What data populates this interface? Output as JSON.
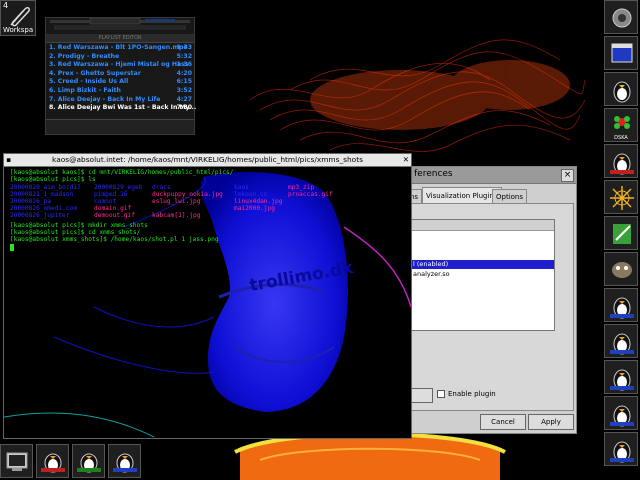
{
  "workspace": {
    "number": "4",
    "label": "Workspa"
  },
  "playlist": {
    "title": "PLAYLIST EDITOR",
    "items": [
      {
        "text": "1. Red Warszawa - Blt 1PO-Sangen.mp3",
        "time": "1:43"
      },
      {
        "text": "2. Prodigy - Breathe",
        "time": "5:32"
      },
      {
        "text": "3. Red Warszawa - Hjemi Mistal og Hass",
        "time": "1:36"
      },
      {
        "text": "4. Prex - Ghetto Superstar",
        "time": "4:20"
      },
      {
        "text": "5. Creed - Inside Us All",
        "time": "6:15"
      },
      {
        "text": "6. Limp Bizkit - Faith",
        "time": "3:52"
      },
      {
        "text": "7. Alice Deejay - Back In My Life",
        "time": "4:27"
      },
      {
        "text": "8. Alice Deejay Bwi Was 1st - Back In My...",
        "time": "7:30",
        "current": true
      }
    ]
  },
  "terminal": {
    "title": "kaos@absolut.intet: /home/kaos/mnt/VIRKELIG/homes/public_html/pics/xmms_shots",
    "lines": [
      {
        "text": "[kaos@absolut kaos]$ cd mnt/VIRKELIG/homes/public_html/pics/",
        "color": "#21e621"
      },
      {
        "text": "[kaos@absolut pics]$ ls",
        "color": "#21e621"
      },
      {
        "text": "[kaos@absolut pics]$ mkdir xmms_shots",
        "color": "#21e621"
      },
      {
        "text": "[kaos@absolut pics]$ cd xmms_shots/",
        "color": "#21e621"
      },
      {
        "text": "[kaos@absolut xmms_shots]$ /home/kaos/shot.pl 1 jass.png",
        "color": "#21e621"
      }
    ],
    "listing": [
      {
        "text": "20000820_aim_bord17",
        "color": "#2a2aff"
      },
      {
        "text": "20000829_egeb",
        "color": "#2a2aff"
      },
      {
        "text": "dracs",
        "color": "#2a2aff"
      },
      {
        "text": "kaos",
        "color": "#2a2aff"
      },
      {
        "text": "mp3_zip",
        "color": "#ff2a9a"
      },
      {
        "text": "20000821_1_madson",
        "color": "#2a2aff"
      },
      {
        "text": "pimped.16",
        "color": "#2a2aff"
      },
      {
        "text": "duckpuppy_nokia.jpg",
        "color": "#ff2a9a"
      },
      {
        "text": "lekoon.cn",
        "color": "#2a2aff"
      },
      {
        "text": "proaccas.gif",
        "color": "#ff2a9a"
      },
      {
        "text": "20000826_pa",
        "color": "#2a2aff"
      },
      {
        "text": "comnot",
        "color": "#2a2aff"
      },
      {
        "text": "eslug_lwi.jpg",
        "color": "#ff2a9a"
      },
      {
        "text": "linux4dan.jpg",
        "color": "#ff2a9a"
      },
      {
        "text": "20000826_omedi.com",
        "color": "#2a2aff"
      },
      {
        "text": "domain.gif",
        "color": "#ff2a9a"
      },
      {
        "text": "mai2000.jpg",
        "color": "#ff2a9a"
      },
      {
        "text": "20000826_jupiter",
        "color": "#2a2aff"
      },
      {
        "text": "demoout.gif",
        "color": "#ff2a9a"
      },
      {
        "text": "kabcam[1].jpg",
        "color": "#ff2a9a"
      }
    ],
    "overlay_text": "trollimo.dk"
  },
  "dialog": {
    "title": "ferences",
    "tabs": [
      {
        "label": "ns"
      },
      {
        "label": "Visualization Plugins"
      },
      {
        "label": "Options"
      }
    ],
    "plugins": [
      {
        "text": "l (enabled)",
        "selected": true
      },
      {
        "text": "analyzer.so",
        "selected": false
      }
    ],
    "enable_label": "Enable plugin",
    "cancel_label": "Cancel",
    "apply_label": "Apply"
  },
  "dock": {
    "labels": [
      "DSKA"
    ]
  }
}
